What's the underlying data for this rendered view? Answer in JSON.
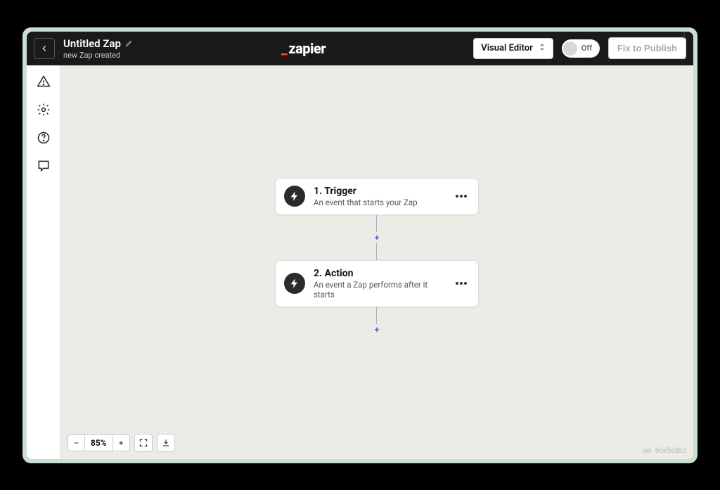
{
  "header": {
    "title": "Untitled Zap",
    "subtitle": "new Zap created",
    "editor_mode": "Visual Editor",
    "toggle_state": "Off",
    "publish_label": "Fix to Publish",
    "logo_text": "zapier"
  },
  "steps": [
    {
      "title": "1. Trigger",
      "desc": "An event that starts your Zap"
    },
    {
      "title": "2. Action",
      "desc": "An event a Zap performs after it starts"
    }
  ],
  "zoom": {
    "level": "85%"
  },
  "footer": {
    "version": "ver. 8de5e3b2"
  }
}
